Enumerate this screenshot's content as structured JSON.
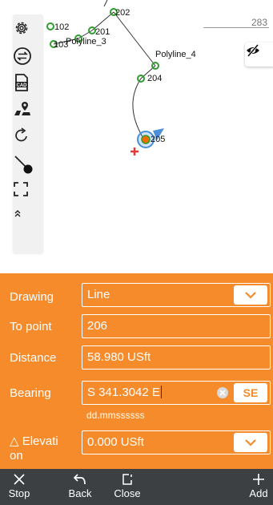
{
  "map": {
    "points": [
      {
        "id": "202",
        "label": "202"
      },
      {
        "id": "201",
        "label": "201"
      },
      {
        "id": "102",
        "label": "102"
      },
      {
        "id": "103",
        "label": "103"
      },
      {
        "id": "204",
        "label": "204"
      },
      {
        "id": "205",
        "label": "205"
      }
    ],
    "polylines": [
      {
        "label": "Polyline_3"
      },
      {
        "label": "Polyline_4"
      }
    ],
    "scale_label": "283",
    "colors": {
      "point_ring": "#2e9d2e",
      "line": "#333333",
      "selection": "#4a90d9",
      "current_point": "#ef6c00",
      "cross": "#e53935"
    }
  },
  "toolbar": {
    "icons": [
      "gear-icon",
      "swap-icon",
      "cad-icon",
      "map-pin-icon",
      "refresh-icon",
      "stakeout-line-icon",
      "fullscreen-icon",
      "double-chevron-up-icon"
    ]
  },
  "visibility_icon": "eye-off-icon",
  "form": {
    "drawing": {
      "label": "Drawing",
      "value": "Line"
    },
    "to_point": {
      "label": "To point",
      "value": "206"
    },
    "distance": {
      "label": "Distance",
      "value": "58.980 USft"
    },
    "bearing": {
      "label": "Bearing",
      "value": "S 341.3042 E",
      "quadrant_button": "SE",
      "format_hint": "dd.mmssssss"
    },
    "elevation": {
      "label_line1": "△ Elevati",
      "label_line2": "on",
      "value": "0.000 USft"
    }
  },
  "accent_color": "#f68b2c",
  "bottom_bar": {
    "stop": "Stop",
    "back": "Back",
    "close": "Close",
    "add": "Add"
  }
}
